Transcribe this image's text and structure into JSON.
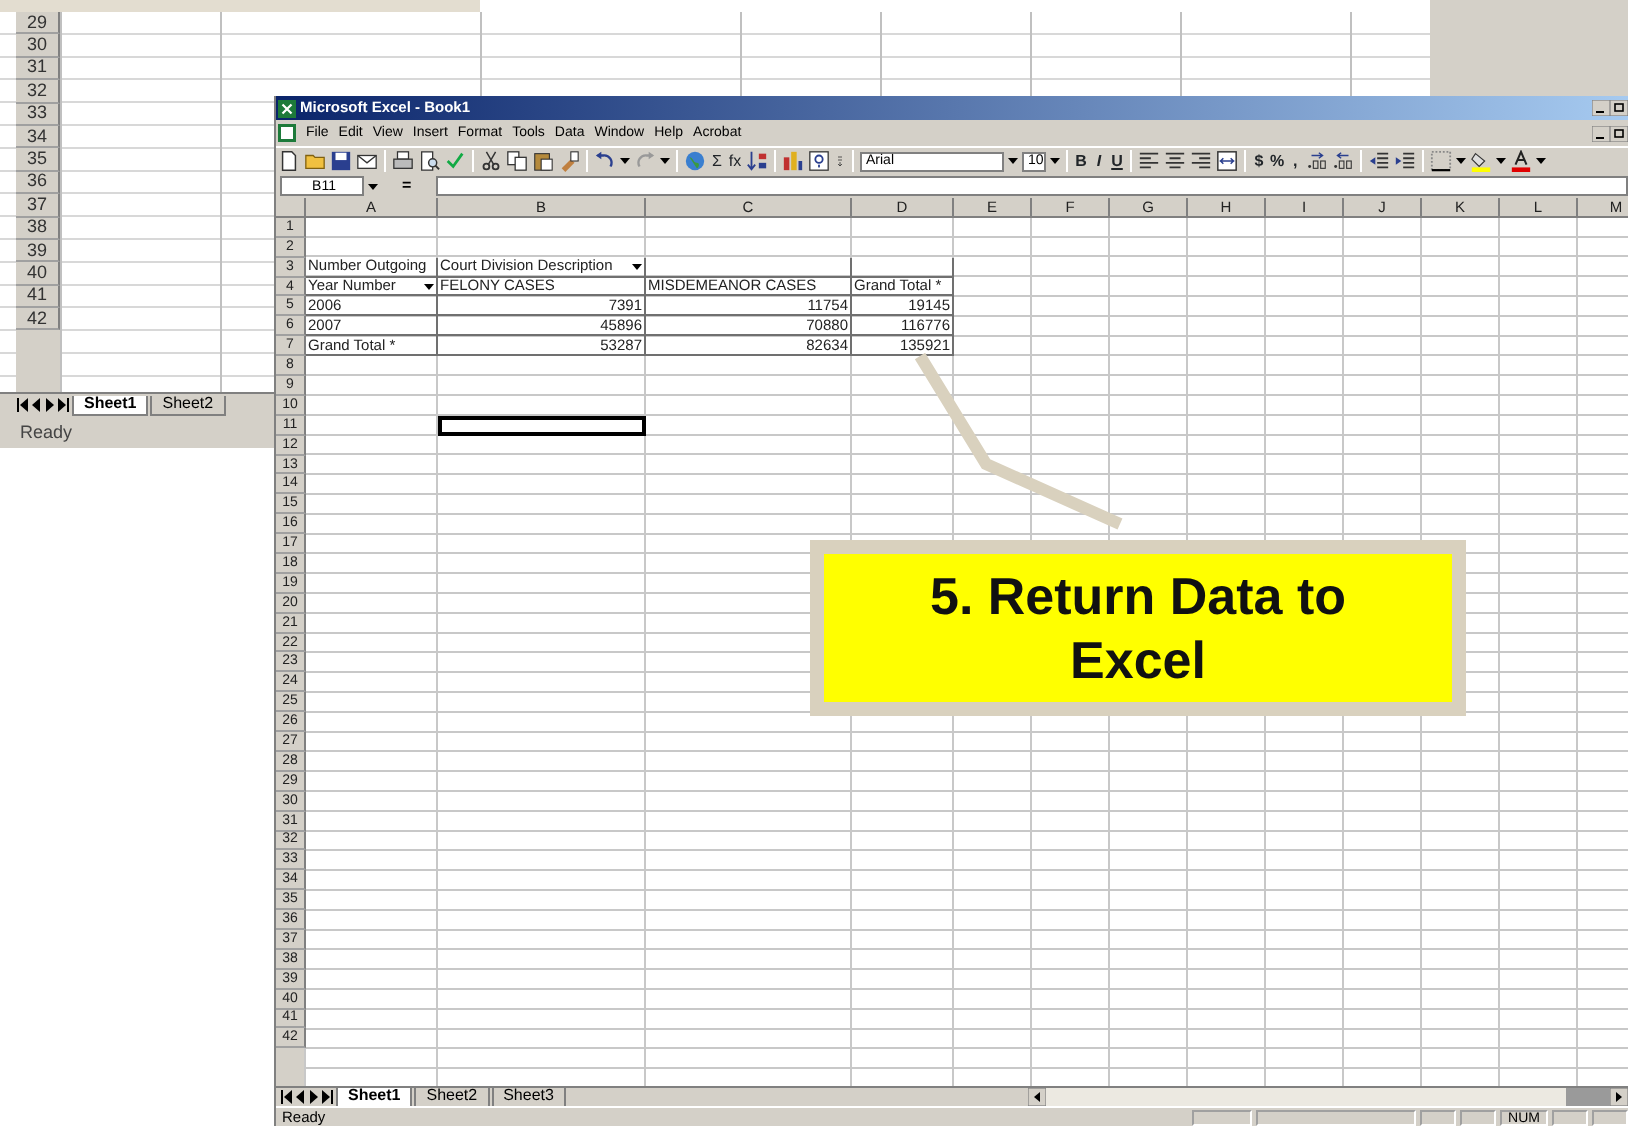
{
  "back_window": {
    "row_numbers": [
      "29",
      "30",
      "31",
      "32",
      "33",
      "34",
      "35",
      "36",
      "37",
      "38",
      "39",
      "40",
      "41",
      "42"
    ],
    "sheet_tabs": [
      {
        "label": "Sheet1",
        "selected": true
      },
      {
        "label": "Sheet2",
        "selected": false
      }
    ],
    "status": "Ready"
  },
  "window": {
    "title": "Microsoft Excel - Book1"
  },
  "menu": [
    "File",
    "Edit",
    "View",
    "Insert",
    "Format",
    "Tools",
    "Data",
    "Window",
    "Help",
    "Acrobat"
  ],
  "toolbar": {
    "formula_buttons": [
      "Σ",
      "fx"
    ],
    "font": "Arial",
    "size": "10",
    "style_buttons": [
      "B",
      "I",
      "U"
    ],
    "number_buttons": [
      "$",
      "%",
      ","
    ]
  },
  "formula_bar": {
    "name_box": "B11",
    "equals": "="
  },
  "sheet": {
    "columns": [
      "A",
      "B",
      "C",
      "D",
      "E",
      "F",
      "G",
      "H",
      "I",
      "J",
      "K",
      "L",
      "M"
    ],
    "rows": [
      {
        "number": "1"
      },
      {
        "number": "2"
      },
      {
        "number": "3",
        "cells": [
          {
            "kind": "label",
            "text": "Number Outgoing",
            "selected": false
          },
          {
            "kind": "dropdown",
            "text": "Court Division Description",
            "selected": false
          },
          {
            "kind": "pivot-blank",
            "selected": false
          },
          {
            "kind": "pivot-blank",
            "selected": false
          }
        ]
      },
      {
        "number": "4",
        "cells": [
          {
            "kind": "dropdown",
            "text": "Year Number",
            "selected": false
          },
          {
            "kind": "label",
            "text": "FELONY CASES",
            "selected": false
          },
          {
            "kind": "label",
            "text": "MISDEMEANOR CASES",
            "selected": false
          },
          {
            "kind": "label",
            "text": "Grand Total *",
            "selected": false
          }
        ]
      },
      {
        "number": "5",
        "cells": [
          {
            "kind": "label",
            "text": "2006",
            "selected": false
          },
          {
            "kind": "number",
            "text": "7391",
            "selected": false
          },
          {
            "kind": "number",
            "text": "11754",
            "selected": false
          },
          {
            "kind": "number",
            "text": "19145",
            "selected": false
          }
        ]
      },
      {
        "number": "6",
        "cells": [
          {
            "kind": "label",
            "text": "2007",
            "selected": false
          },
          {
            "kind": "number",
            "text": "45896",
            "selected": false
          },
          {
            "kind": "number",
            "text": "70880",
            "selected": false
          },
          {
            "kind": "number",
            "text": "116776",
            "selected": false
          }
        ]
      },
      {
        "number": "7",
        "cells": [
          {
            "kind": "label",
            "text": "Grand Total *",
            "selected": false
          },
          {
            "kind": "number",
            "text": "53287",
            "selected": false
          },
          {
            "kind": "number",
            "text": "82634",
            "selected": false
          },
          {
            "kind": "number",
            "text": "135921",
            "selected": false
          }
        ]
      },
      {
        "number": "8"
      },
      {
        "number": "9"
      },
      {
        "number": "10"
      },
      {
        "number": "11",
        "cells": [
          {
            "kind": "empty",
            "selected": false
          },
          {
            "kind": "empty",
            "selected": true
          }
        ]
      },
      {
        "number": "12"
      },
      {
        "number": "13"
      },
      {
        "number": "14"
      },
      {
        "number": "15"
      },
      {
        "number": "16"
      },
      {
        "number": "17"
      },
      {
        "number": "18"
      },
      {
        "number": "19"
      },
      {
        "number": "20"
      },
      {
        "number": "21"
      },
      {
        "number": "22"
      },
      {
        "number": "23"
      },
      {
        "number": "24"
      },
      {
        "number": "25"
      },
      {
        "number": "26"
      },
      {
        "number": "27"
      },
      {
        "number": "28"
      },
      {
        "number": "29"
      },
      {
        "number": "30"
      },
      {
        "number": "31"
      },
      {
        "number": "32"
      },
      {
        "number": "33"
      },
      {
        "number": "34"
      },
      {
        "number": "35"
      },
      {
        "number": "36"
      },
      {
        "number": "37"
      },
      {
        "number": "38"
      },
      {
        "number": "39"
      },
      {
        "number": "40"
      },
      {
        "number": "41"
      },
      {
        "number": "42"
      }
    ]
  },
  "sheet_tabs": [
    {
      "label": "Sheet1",
      "selected": true
    },
    {
      "label": "Sheet2",
      "selected": false
    },
    {
      "label": "Sheet3",
      "selected": false
    }
  ],
  "status_bar": {
    "status": "Ready",
    "indicator": "NUM"
  },
  "callout": {
    "text": "5. Return Data to Excel"
  }
}
